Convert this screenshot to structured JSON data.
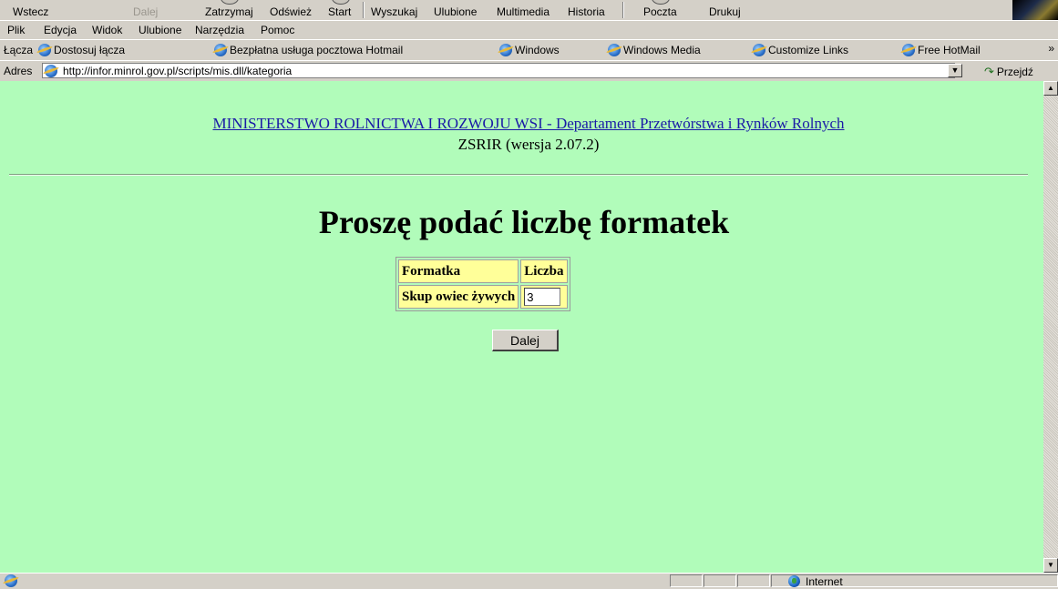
{
  "toolbar": {
    "back": "Wstecz",
    "forward": "Dalej",
    "stop": "Zatrzymaj",
    "refresh": "Odśwież",
    "home": "Start",
    "search": "Wyszukaj",
    "favorites": "Ulubione",
    "media": "Multimedia",
    "history": "Historia",
    "mail": "Poczta",
    "print": "Drukuj"
  },
  "menu": {
    "file": "Plik",
    "edit": "Edycja",
    "view": "Widok",
    "favorites": "Ulubione",
    "tools": "Narzędzia",
    "help": "Pomoc"
  },
  "links_bar": {
    "label": "Łącza",
    "items": [
      "Dostosuj łącza",
      "Bezpłatna usługa pocztowa Hotmail",
      "Windows",
      "Windows Media",
      "Customize Links",
      "Free HotMail"
    ],
    "more": "»"
  },
  "address_bar": {
    "label": "Adres",
    "url": "http://infor.minrol.gov.pl/scripts/mis.dll/kategoria",
    "go": "Przejdź"
  },
  "page": {
    "header_link": "MINISTERSTWO ROLNICTWA I ROZWOJU WSI - Departament Przetwórstwa i Rynków Rolnych",
    "version": "ZSRIR (wersja 2.07.2)",
    "title": "Proszę podać liczbę formatek",
    "table": {
      "col_form": "Formatka",
      "col_count": "Liczba",
      "row_label": "Skup owiec żywych",
      "row_value": "3"
    },
    "next_button": "Dalej"
  },
  "status_bar": {
    "zone": "Internet"
  },
  "colors": {
    "content_bg": "#b1fcba",
    "table_cell_bg": "#ffff99",
    "link": "#1a1aa6",
    "chrome": "#d4d0c8"
  }
}
